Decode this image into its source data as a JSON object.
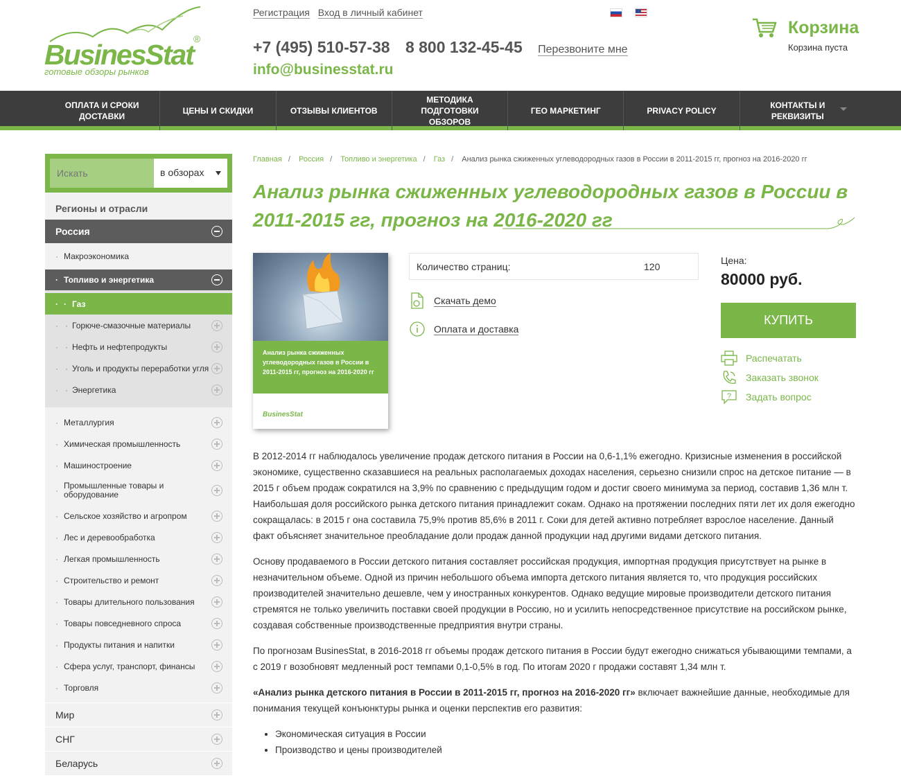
{
  "brand": {
    "name": "BusinesStat",
    "reg": "®",
    "tagline": "готовые обзоры рынков"
  },
  "header": {
    "register": "Регистрация",
    "login": "Вход в личный кабинет",
    "phone1": "+7 (495) 510-57-38",
    "phone2": "8 800 132-45-45",
    "callback": "Перезвоните мне",
    "email": "info@businesstat.ru",
    "langs": [
      "ru",
      "en"
    ]
  },
  "cart": {
    "title": "Корзина",
    "status": "Корзина пуста"
  },
  "nav": [
    "Оплата и сроки доставки",
    "Цены и скидки",
    "Отзывы клиентов",
    "Методика подготовки обзоров",
    "Гео маркетинг",
    "Privacy Policy",
    "Контакты и реквизиты"
  ],
  "sidebar": {
    "search_placeholder": "Искать",
    "search_scope": "в обзорах",
    "heading": "Регионы и отрасли",
    "region": "Россия",
    "sub_top": "Макроэкономика",
    "active_group": "Топливо и энергетика",
    "active_item": "Газ",
    "group_items": [
      "Горюче-смазочные материалы",
      "Нефть и нефтепродукты",
      "Уголь и продукты переработки угля",
      "Энергетика"
    ],
    "industries": [
      "Металлургия",
      "Химическая промышленность",
      "Машиностроение",
      "Промышленные товары и оборудование",
      "Сельское хозяйство и агропром",
      "Лес и деревообработка",
      "Легкая промышленность",
      "Строительство и ремонт",
      "Товары длительного пользования",
      "Товары повседневного спроса",
      "Продукты питания и напитки",
      "Сфера услуг, транспорт, финансы",
      "Торговля"
    ],
    "regions": [
      "Мир",
      "СНГ",
      "Беларусь"
    ]
  },
  "breadcrumbs": [
    "Главная",
    "Россия",
    "Топливо и энергетика",
    "Газ",
    "Анализ рынка сжиженных углеводородных газов в России в 2011-2015 гг, прогноз на 2016-2020 гг"
  ],
  "product": {
    "title": "Анализ рынка сжиженных углеводородных газов в России в 2011-2015 гг, прогноз на 2016-2020 гг",
    "cover_title": "Анализ рынка сжиженных углеводородных газов в России в 2011-2015 гг, прогноз на 2016-2020 гг",
    "pages_label": "Количество страниц:",
    "pages_value": "120",
    "demo_link": "Скачать демо",
    "delivery_link": "Оплата и доставка",
    "price_label": "Цена:",
    "price": "80000 руб.",
    "buy_label": "КУПИТЬ",
    "print_label": "Распечатать",
    "call_label": "Заказать звонок",
    "ask_label": "Задать вопрос"
  },
  "article": {
    "p1": "В 2012-2014 гг наблюдалось увеличение продаж детского питания в России на 0,6-1,1% ежегодно. Кризисные изменения в российской экономике, существенно сказавшиеся на реальных располагаемых доходах населения, серьезно снизили спрос на детское питание — в 2015 г объем продаж сократился на 3,9% по сравнению с предыдущим годом и достиг своего минимума за период, составив 1,36 млн т. Наибольшая доля российского рынка детского питания принадлежит сокам. Однако на протяжении последних пяти лет их доля ежегодно сокращалась: в 2015 г она составила 75,9% против 85,6% в 2011 г. Соки для детей активно потребляет взрослое население. Данный факт объясняет значительное преобладание доли продаж данной продукции над другими видами детского питания.",
    "p2": "Основу продаваемого в России детского питания составляет российская продукция, импортная продукция присутствует на рынке в незначительном объеме. Одной из причин небольшого объема импорта детского питания является то, что продукция российских производителей значительно дешевле, чем у иностранных конкурентов. Однако ведущие мировые производители детского питания стремятся не только увеличить поставки своей продукции в Россию, но и усилить непосредственное присутствие на российском рынке, создавая собственные производственные предприятия внутри страны.",
    "p3": "По прогнозам BusinesStat, в 2016-2018 гг объемы продаж детского питания в России будут ежегодно снижаться убывающими темпами, а с 2019 г возобновят медленный рост темпами 0,1-0,5% в год. По итогам 2020 г продажи составят 1,34 млн т.",
    "p4_bold": "«Анализ рынка детского питания в России в 2011-2015 гг, прогноз на 2016-2020 гг»",
    "p4_rest": " включает важнейшие данные, необходимые для понимания текущей конъюнктуры рынка и оценки перспектив его развития:",
    "bullets": [
      "Экономическая ситуация в России",
      "Производство и цены производителей"
    ]
  },
  "colors": {
    "brand_green": "#7ab648",
    "nav_dark": "#3d3d3d",
    "sidebar_dark": "#5c5c5c"
  }
}
